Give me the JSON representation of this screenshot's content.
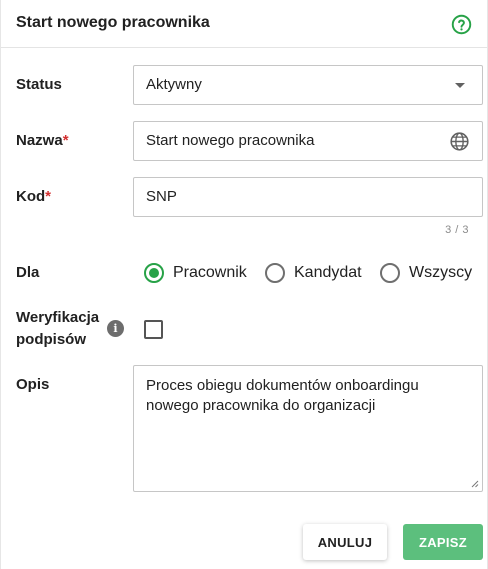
{
  "dialog": {
    "title": "Start nowego pracownika"
  },
  "form": {
    "status": {
      "label": "Status",
      "value": "Aktywny"
    },
    "name": {
      "label": "Nazwa",
      "required_mark": "*",
      "value": "Start nowego pracownika"
    },
    "code": {
      "label": "Kod",
      "required_mark": "*",
      "value": "SNP",
      "counter": "3 / 3"
    },
    "for": {
      "label": "Dla",
      "options": [
        {
          "label": "Pracownik",
          "selected": true
        },
        {
          "label": "Kandydat",
          "selected": false
        },
        {
          "label": "Wszyscy",
          "selected": false
        }
      ]
    },
    "signature_verification": {
      "label_line1": "Weryfikacja",
      "label_line2": "podpisów",
      "info_glyph": "i",
      "checked": false
    },
    "description": {
      "label": "Opis",
      "value": "Proces obiegu dokumentów onboardingu nowego pracownika do organizacji"
    }
  },
  "actions": {
    "cancel_label": "ANULUJ",
    "save_label": "ZAPISZ"
  },
  "colors": {
    "accent": "#27a247",
    "save_button": "#5cbf7d",
    "required": "#d32f2f"
  },
  "icons": {
    "help": "help-circle-icon",
    "globe": "globe-icon",
    "info": "info-icon",
    "dropdown": "chevron-down-icon"
  }
}
